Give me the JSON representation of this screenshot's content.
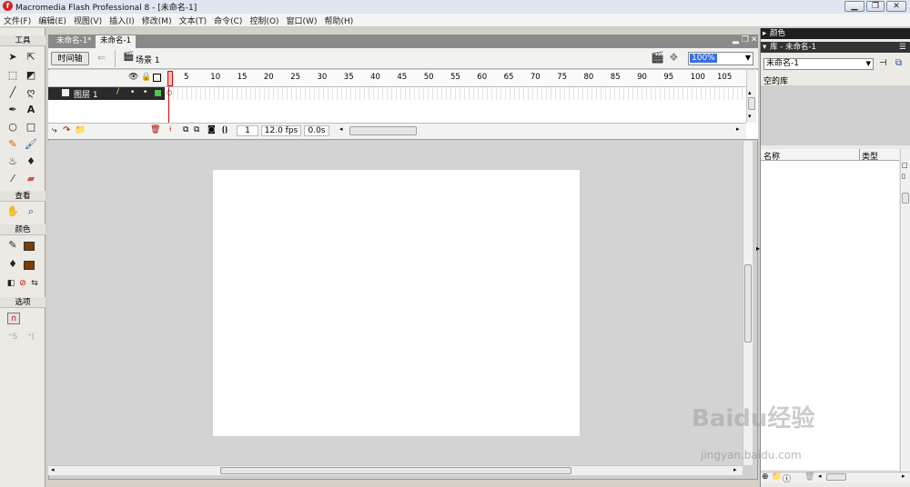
{
  "window": {
    "title": "Macromedia Flash Professional 8 - [未命名-1]",
    "icon": "flash-icon",
    "buttons": [
      "minimize",
      "restore",
      "close"
    ]
  },
  "menu": [
    "文件(F)",
    "编辑(E)",
    "视图(V)",
    "插入(I)",
    "修改(M)",
    "文本(T)",
    "命令(C)",
    "控制(O)",
    "窗口(W)",
    "帮助(H)"
  ],
  "tools": {
    "section_tools": "工具",
    "section_view": "查看",
    "section_colors": "颜色",
    "section_options": "选项",
    "stroke_color": "#7a3e0c",
    "fill_color": "#7a3e0c"
  },
  "document": {
    "tabs": [
      "未命名-1*",
      "未命名-1"
    ],
    "active_tab": 1,
    "timeline_button": "时间轴",
    "scene_label": "场景 1",
    "zoom": "100%"
  },
  "timeline": {
    "frame_numbers": [
      "5",
      "10",
      "15",
      "20",
      "25",
      "30",
      "35",
      "40",
      "45",
      "50",
      "55",
      "60",
      "65",
      "70",
      "75",
      "80",
      "85",
      "90",
      "95",
      "100",
      "105"
    ],
    "layer_name": "图层 1",
    "current_frame": "1",
    "fps": "12.0 fps",
    "time": "0.0s"
  },
  "right_panels": {
    "color_panel_title": "颜色",
    "library_panel_title": "库 - 未命名-1",
    "library_select": "未命名-1",
    "library_status": "空的库",
    "col_name": "名称",
    "col_type": "类型"
  },
  "watermark": {
    "brand": "Baidu经验",
    "url": "jingyan.baidu.com"
  }
}
